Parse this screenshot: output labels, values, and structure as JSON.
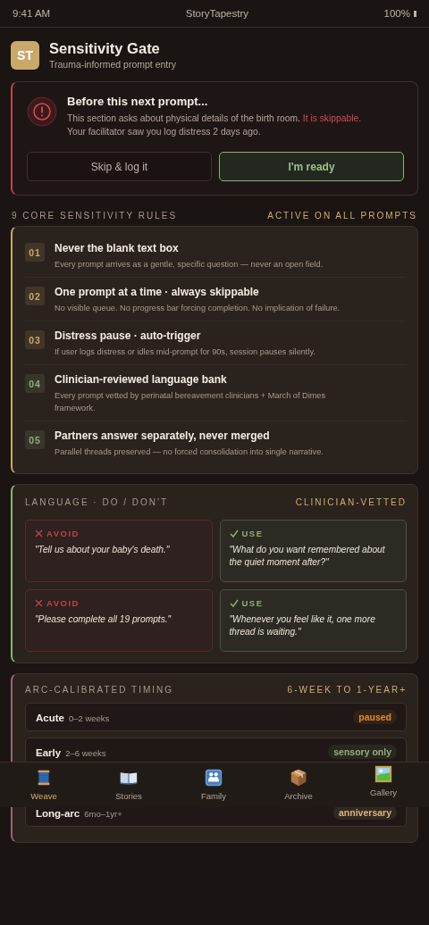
{
  "status_bar": {
    "time": "9:41 AM",
    "app": "StoryTapestry",
    "battery": "100%"
  },
  "header": {
    "logo": "ST",
    "title": "Sensitivity Gate",
    "subtitle": "Trauma-informed prompt entry"
  },
  "alert": {
    "title": "Before this next prompt...",
    "message": "This section asks about physical details of the birth room.",
    "highlight": "It is skippable.",
    "note": "Your facilitator saw you log distress 2 days ago.",
    "buttons": [
      {
        "label": "Skip & log it",
        "kind": "secondary"
      },
      {
        "label": "I'm ready",
        "kind": "primary"
      }
    ]
  },
  "rules": {
    "heading": "9 CORE SENSITIVITY RULES",
    "badge": "ACTIVE ON ALL PROMPTS",
    "items": [
      {
        "number": "01",
        "title": "Never the blank text box",
        "description": "Every prompt arrives as a gentle, specific question — never an open field.",
        "color": "#c9a86a"
      },
      {
        "number": "02",
        "title": "One prompt at a time · always skippable",
        "description": "No visible queue. No progress bar forcing completion. No implication of failure.",
        "color": "#c9a86a"
      },
      {
        "number": "03",
        "title": "Distress pause · auto-trigger",
        "description": "If user logs distress or idles mid-prompt for 90s, session pauses silently.",
        "color": "#c9a86a"
      },
      {
        "number": "04",
        "title": "Clinician-reviewed language bank",
        "description": "Every prompt vetted by perinatal bereavement clinicians + March of Dimes framework.",
        "color": "#8fae7a"
      },
      {
        "number": "05",
        "title": "Partners answer separately, never merged",
        "description": "Parallel threads preserved — no forced consolidation into single narrative.",
        "color": "#8fae7a"
      }
    ]
  },
  "language": {
    "heading": "LANGUAGE · DO / DON'T",
    "badge": "CLINICIAN-VETTED",
    "examples": [
      {
        "kind": "avoid",
        "label": "AVOID",
        "text": "\"Tell us about your baby's death.\""
      },
      {
        "kind": "use",
        "label": "USE",
        "text": "\"What do you want remembered about the quiet moment after?\""
      },
      {
        "kind": "avoid",
        "label": "AVOID",
        "text": "\"Please complete all 19 prompts.\""
      },
      {
        "kind": "use",
        "label": "USE",
        "text": "\"Whenever you feel like it, one more thread is waiting.\""
      }
    ]
  },
  "timing": {
    "heading": "ARC-CALIBRATED TIMING",
    "badge": "6-WEEK TO 1-YEAR+",
    "phases": [
      {
        "name": "Acute",
        "range": "0–2 weeks",
        "tag": "paused",
        "color": "#e08a2c"
      },
      {
        "name": "Early",
        "range": "2–6 weeks",
        "tag": "sensory only",
        "color": "#8fae7a"
      },
      {
        "name": "Long-arc",
        "range": "6mo–1yr+",
        "tag": "anniversary",
        "color": "#d6b57f"
      }
    ]
  },
  "tab_bar": [
    {
      "label": "Weave",
      "selected": true
    },
    {
      "label": "Stories",
      "selected": false
    },
    {
      "label": "Family",
      "selected": false
    },
    {
      "label": "Archive",
      "selected": false
    },
    {
      "label": "Gallery",
      "selected": false
    }
  ]
}
